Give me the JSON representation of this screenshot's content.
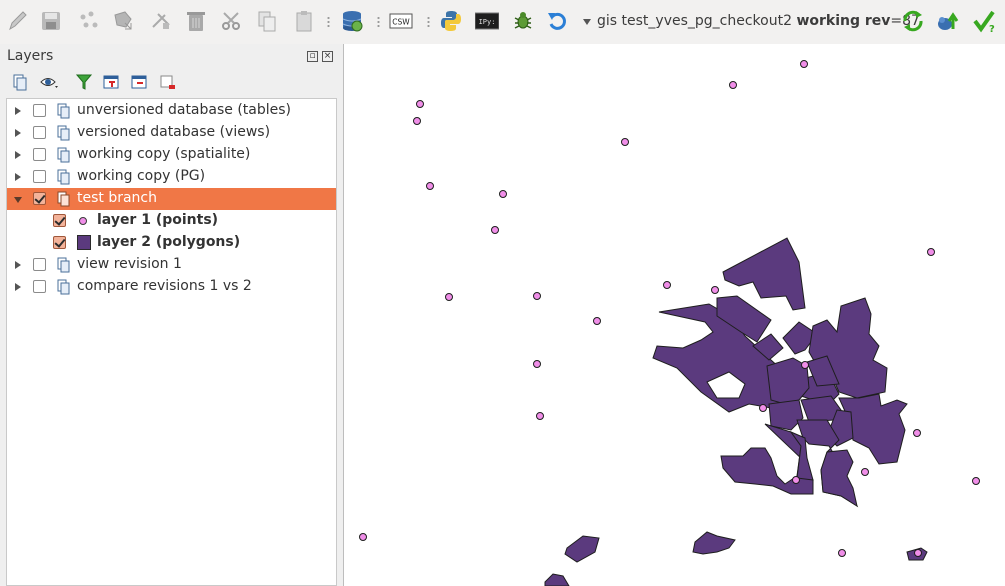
{
  "toolbar": {
    "buttons": [
      {
        "name": "toggle-editing-icon"
      },
      {
        "name": "save-edits-icon"
      },
      {
        "name": "add-feature-icon"
      },
      {
        "name": "move-feature-icon"
      },
      {
        "name": "node-tool-icon"
      },
      {
        "name": "delete-selected-icon"
      },
      {
        "name": "cut-features-icon"
      },
      {
        "name": "copy-features-icon"
      },
      {
        "name": "paste-features-icon"
      },
      {
        "name": "database-icon"
      },
      {
        "name": "csw-icon",
        "text": "CSW"
      },
      {
        "name": "python-console-icon"
      },
      {
        "name": "ipython-console-icon",
        "text": "IPy:"
      },
      {
        "name": "bug-icon"
      },
      {
        "name": "undo-icon"
      }
    ],
    "branch_prefix": "gis test_yves_pg_checkout2 ",
    "branch_bold": "working rev",
    "branch_suffix": "=87",
    "right_buttons": [
      {
        "name": "update-icon"
      },
      {
        "name": "commit-icon"
      },
      {
        "name": "check-icon"
      }
    ]
  },
  "layers_panel": {
    "title": "Layers",
    "tree": [
      {
        "label": "unversioned database (tables)",
        "kind": "group",
        "checked": false,
        "expanded": false,
        "selected": false,
        "bold": false
      },
      {
        "label": "versioned database (views)",
        "kind": "group",
        "checked": false,
        "expanded": false,
        "selected": false,
        "bold": false
      },
      {
        "label": "working copy (spatialite)",
        "kind": "group",
        "checked": false,
        "expanded": false,
        "selected": false,
        "bold": false
      },
      {
        "label": "working copy (PG)",
        "kind": "group",
        "checked": false,
        "expanded": false,
        "selected": false,
        "bold": false
      },
      {
        "label": "test branch",
        "kind": "group",
        "checked": true,
        "expanded": true,
        "selected": true,
        "bold": false
      },
      {
        "label": "layer 1 (points)",
        "kind": "point-layer",
        "checked": true,
        "selected": false,
        "bold": true
      },
      {
        "label": "layer 2 (polygons)",
        "kind": "polygon-layer",
        "checked": true,
        "selected": false,
        "bold": true
      },
      {
        "label": "view revision 1",
        "kind": "group",
        "checked": false,
        "expanded": false,
        "selected": false,
        "bold": false
      },
      {
        "label": "compare revisions 1 vs 2",
        "kind": "group",
        "checked": false,
        "expanded": false,
        "selected": false,
        "bold": false
      }
    ]
  },
  "colors": {
    "selection": "#f07746",
    "point_fill": "#f08ee8",
    "polygon_fill": "#5b3a7e",
    "outline": "#1e1e1e"
  }
}
